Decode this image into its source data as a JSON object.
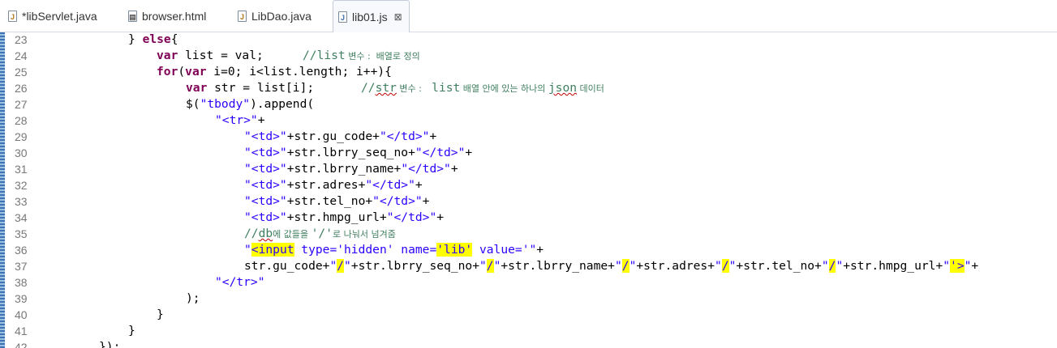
{
  "tabs": [
    {
      "label": "*libServlet.java",
      "icon": "java-file-icon"
    },
    {
      "label": "browser.html",
      "icon": "html-file-icon"
    },
    {
      "label": "LibDao.java",
      "icon": "java-file-icon"
    },
    {
      "label": "lib01.js",
      "icon": "js-file-icon",
      "active": true,
      "close": "⊠"
    }
  ],
  "line_numbers": [
    "23",
    "24",
    "25",
    "26",
    "27",
    "28",
    "29",
    "30",
    "31",
    "32",
    "33",
    "34",
    "35",
    "36",
    "37",
    "38",
    "39",
    "40",
    "41",
    "42"
  ],
  "code": {
    "l23": {
      "close": "} ",
      "else": "else",
      "brace": "{"
    },
    "l24": {
      "var": "var",
      "text": " list = val;",
      "comment": "//list",
      "comment_ko": " 변수 :  배열로 정의"
    },
    "l25": {
      "for": "for",
      "p1": "(",
      "var": "var",
      "text": " i=0; i<list.length; i++){"
    },
    "l26": {
      "var": "var",
      "text": " str = list[i];",
      "comment_a": "//",
      "comment_b": "str",
      "comment_ko1": " 변수 : ",
      "comment_c": " list",
      "comment_ko2": " 배열 안에 있는 하나의 ",
      "comment_d": "json",
      "comment_ko3": " 데이터"
    },
    "l27": {
      "a": "$(",
      "s": "\"tbody\"",
      "b": ").append("
    },
    "l28": {
      "s": "\"<tr>\"",
      "t": "+"
    },
    "l29": {
      "s1": "\"<td>\"",
      "t1": "+str.gu_code+",
      "s2": "\"</td>\"",
      "t2": "+"
    },
    "l30": {
      "s1": "\"<td>\"",
      "t1": "+str.lbrry_seq_no+",
      "s2": "\"</td>\"",
      "t2": "+"
    },
    "l31": {
      "s1": "\"<td>\"",
      "t1": "+str.lbrry_name+",
      "s2": "\"</td>\"",
      "t2": "+"
    },
    "l32": {
      "s1": "\"<td>\"",
      "t1": "+str.adres+",
      "s2": "\"</td>\"",
      "t2": "+"
    },
    "l33": {
      "s1": "\"<td>\"",
      "t1": "+str.tel_no+",
      "s2": "\"</td>\"",
      "t2": "+"
    },
    "l34": {
      "s1": "\"<td>\"",
      "t1": "+str.hmpg_url+",
      "s2": "\"</td>\"",
      "t2": "+"
    },
    "l35": {
      "c1": "//",
      "c2": "db",
      "ko1": "에 값들을 ",
      "c3": "'/'",
      "ko2": "로 나눠서 넘겨줌"
    },
    "l36": {
      "q1": "\"",
      "h1": "<input",
      "s1": " type='hidden' name=",
      "h2": "'lib'",
      "s2": " value='\"",
      "t": "+"
    },
    "l37": {
      "t1": "str.gu_code+",
      "q1": "\"",
      "h1": "/",
      "q2": "\"",
      "t2": "+str.lbrry_seq_no+",
      "q3": "\"",
      "h2": "/",
      "q4": "\"",
      "t3": "+str.lbrry_name+",
      "q5": "\"",
      "h3": "/",
      "q6": "\"",
      "t4": "+str.adres+",
      "q7": "\"",
      "h4": "/",
      "q8": "\"",
      "t5": "+str.tel_no+",
      "q9": "\"",
      "h5": "/",
      "q10": "\"",
      "t6": "+str.hmpg_url+",
      "q11": "\"",
      "h6": "'>",
      "q12": "\"",
      "t7": "+"
    },
    "l38": {
      "s": "\"</tr>\""
    },
    "l39": {
      "t": ");"
    },
    "l40": {
      "t": "}"
    },
    "l41": {
      "t": "}"
    },
    "l42": {
      "t": "});"
    }
  },
  "colors": {
    "keyword": "#7f0055",
    "string": "#2a00ff",
    "comment": "#3f7f5f",
    "highlight": "#ffff00",
    "line_number": "#787878"
  }
}
